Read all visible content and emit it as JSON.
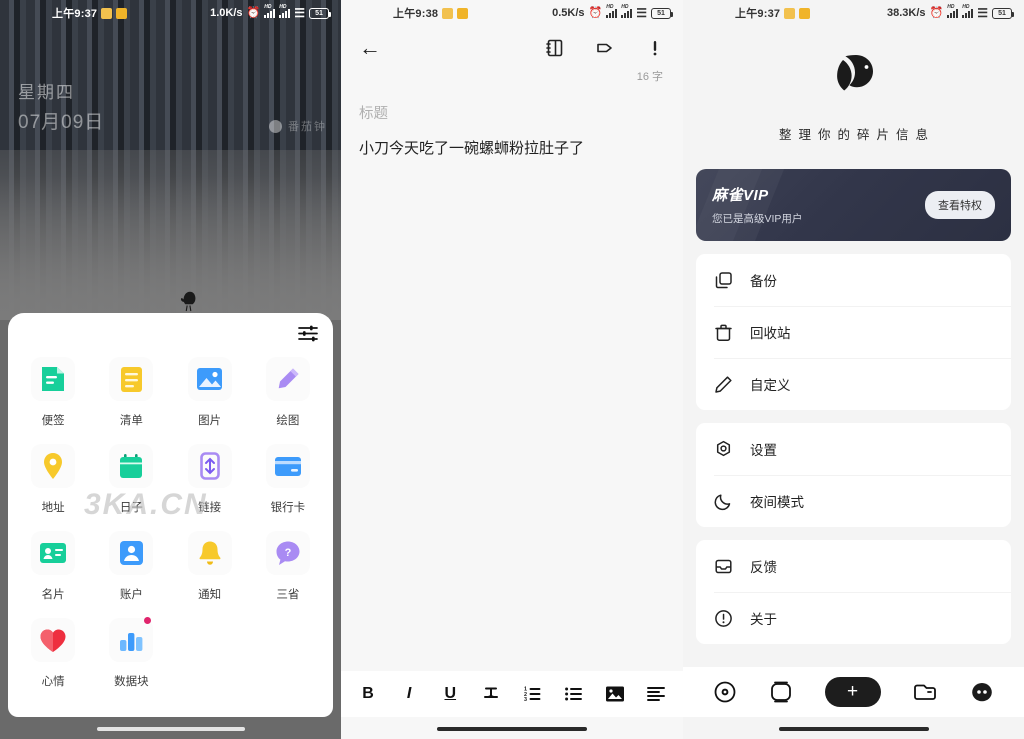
{
  "panels": {
    "launcher": {
      "status": {
        "time": "上午9:37",
        "net_speed": "1.0K/s",
        "battery": "51"
      },
      "widget": {
        "weekday": "星期四",
        "date": "07月09日",
        "right_label": "番茄钟"
      },
      "sheet": {
        "settings_icon": "sliders-icon",
        "apps": [
          {
            "label": "便签",
            "icon": "note-icon",
            "color": "#1dd1a1",
            "badge": false
          },
          {
            "label": "清单",
            "icon": "checklist-icon",
            "color": "#f5c21b",
            "badge": false
          },
          {
            "label": "图片",
            "icon": "image-icon",
            "color": "#3b9dff",
            "badge": false
          },
          {
            "label": "绘图",
            "icon": "pencil-icon",
            "color": "#a78bfa",
            "badge": false
          },
          {
            "label": "地址",
            "icon": "location-pin-icon",
            "color": "#f5c21b",
            "badge": false
          },
          {
            "label": "日子",
            "icon": "calendar-icon",
            "color": "#1dd1a1",
            "badge": false
          },
          {
            "label": "链接",
            "icon": "link-icon",
            "color": "#a78bfa",
            "badge": false
          },
          {
            "label": "银行卡",
            "icon": "credit-card-icon",
            "color": "#3b9dff",
            "badge": false
          },
          {
            "label": "名片",
            "icon": "contact-card-icon",
            "color": "#1dd1a1",
            "badge": false
          },
          {
            "label": "账户",
            "icon": "account-icon",
            "color": "#3b9dff",
            "badge": false
          },
          {
            "label": "通知",
            "icon": "bell-icon",
            "color": "#f5c21b",
            "badge": false
          },
          {
            "label": "三省",
            "icon": "question-bubble-icon",
            "color": "#a78bfa",
            "badge": false
          },
          {
            "label": "心情",
            "icon": "heart-icon",
            "color": "#ee2f3f",
            "badge": false
          },
          {
            "label": "数据块",
            "icon": "bar-chart-icon",
            "color": "#3b9dff",
            "badge": true
          }
        ]
      },
      "watermark": "3KA.CN"
    },
    "editor": {
      "status": {
        "time": "上午9:38",
        "net_speed": "0.5K/s",
        "battery": "51"
      },
      "toolbar": {
        "back_icon": "back-arrow-icon",
        "notebook_icon": "notebook-icon",
        "tag_icon": "tag-icon",
        "priority_icon": "exclamation-icon"
      },
      "word_count": "16 字",
      "title_placeholder": "标题",
      "body_text": "小刀今天吃了一碗螺蛳粉拉肚子了",
      "format_tools": [
        {
          "name": "bold-button",
          "glyph": "B"
        },
        {
          "name": "italic-button",
          "glyph": "I"
        },
        {
          "name": "underline-button",
          "glyph": "U"
        },
        {
          "name": "strikethrough-button",
          "glyph": "T"
        },
        {
          "name": "ordered-list-button",
          "glyph": ""
        },
        {
          "name": "bullet-list-button",
          "glyph": ""
        },
        {
          "name": "insert-image-button",
          "glyph": ""
        },
        {
          "name": "align-button",
          "glyph": ""
        }
      ]
    },
    "profile": {
      "status": {
        "time": "上午9:37",
        "net_speed": "38.3K/s",
        "battery": "51"
      },
      "logo_icon": "sparrow-logo-icon",
      "tagline": "整理你的碎片信息",
      "vip": {
        "title": "麻雀VIP",
        "subtitle": "您已是高级VIP用户",
        "button": "查看特权",
        "bg_color": "#34384b"
      },
      "menu_groups": [
        [
          {
            "label": "备份",
            "icon": "copy-icon"
          },
          {
            "label": "回收站",
            "icon": "trash-icon"
          },
          {
            "label": "自定义",
            "icon": "pencil-edit-icon"
          }
        ],
        [
          {
            "label": "设置",
            "icon": "gear-icon"
          },
          {
            "label": "夜间模式",
            "icon": "moon-icon"
          }
        ],
        [
          {
            "label": "反馈",
            "icon": "inbox-icon"
          },
          {
            "label": "关于",
            "icon": "info-icon"
          }
        ]
      ],
      "tabbar": [
        {
          "name": "tab-home",
          "icon": "circle-target-icon"
        },
        {
          "name": "tab-cards",
          "icon": "capsule-icon"
        },
        {
          "name": "tab-add",
          "icon": "plus-icon"
        },
        {
          "name": "tab-folder",
          "icon": "folder-icon"
        },
        {
          "name": "tab-profile",
          "icon": "sparrow-filled-icon"
        }
      ]
    }
  }
}
